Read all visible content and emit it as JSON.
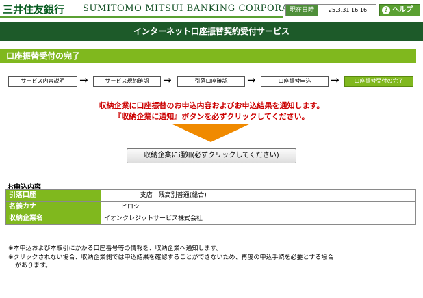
{
  "header": {
    "logo_jp": "三井住友銀行",
    "logo_en": "SUMITOMO MITSUI BANKING CORPORATION",
    "datetime_label": "現在日時",
    "datetime_value": "25.3.31 16:16",
    "help_label": "ヘルプ",
    "help_icon": "?"
  },
  "title": "インターネット口座振替契約受付サービス",
  "section_title": "口座振替受付の完了",
  "steps": [
    {
      "label": "サービス内容説明"
    },
    {
      "label": "サービス規約確認"
    },
    {
      "label": "引落口座確認"
    },
    {
      "label": "口座振替申込"
    },
    {
      "label": "口座振替受付の完了"
    }
  ],
  "step_arrow": "→",
  "notice": {
    "line1": "収納企業に口座振替のお申込内容およびお申込結果を通知します。",
    "line2": "『収納企業に通知』ボタンを必ずクリックしてください。"
  },
  "notify_button": "収納企業に通知(必ずクリックしてください)",
  "application": {
    "title": "お申込内容",
    "rows": [
      {
        "label": "引落口座",
        "prefix": ":",
        "text": "支店　残高別普通(総合)"
      },
      {
        "label": "名義カナ",
        "text": "ヒロシ"
      },
      {
        "label": "収納企業名",
        "text": "イオンクレジットサービス株式会社"
      }
    ]
  },
  "notes": {
    "note1": "※本申込および本取引にかかる口座番号等の情報を、収納企業へ通知します。",
    "note2_line1": "※クリックされない場合、収納企業側では申込結果を確認することができないため、再度の申込手続を必要とする場合",
    "note2_line2": "があります。"
  },
  "colors": {
    "brand_green": "#1d5a29",
    "accent_green": "#80b81e",
    "notice_red": "#cc0000",
    "arrow_orange": "#f08a00"
  }
}
